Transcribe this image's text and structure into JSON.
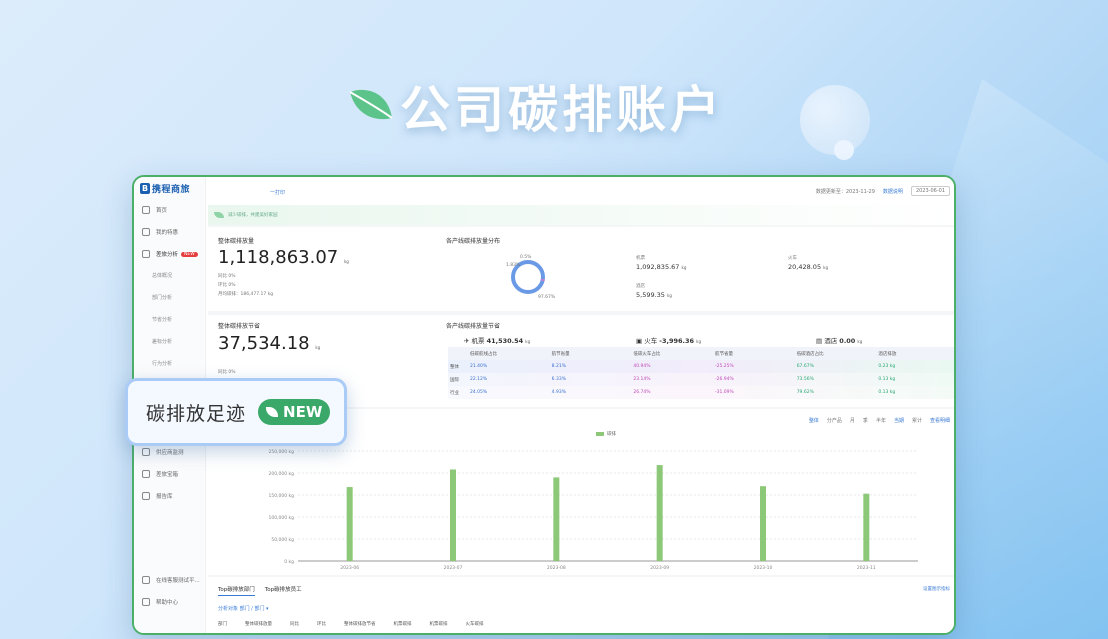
{
  "hero": {
    "title": "公司碳排账户"
  },
  "popup": {
    "label": "碳排放足迹",
    "badge": "NEW"
  },
  "sidebar": {
    "brand": "携程商旅",
    "items": [
      {
        "label": "首页"
      },
      {
        "label": "我的特惠"
      },
      {
        "label": "差旅分析",
        "badge": "NEW"
      }
    ],
    "sub_items": [
      "总体概况",
      "部门分析",
      "节省分析",
      "差标分析",
      "行为分析"
    ],
    "lower_items": [
      "供应商监测",
      "差旅宝箱",
      "报告库"
    ],
    "bottom_items": [
      "在线客服测试平...",
      "帮助中心"
    ]
  },
  "topbar": {
    "tab": "一打印",
    "update_text": "数据更新至：2023-11-29",
    "help": "数据说明",
    "date": "2023-06-01"
  },
  "banner": {
    "text": "减少碳排，共建美好家园"
  },
  "card1": {
    "title": "整体碳排放量",
    "value": "1,118,863.07",
    "unit": "kg",
    "rows": [
      "同比  0%",
      "环比  0%",
      "月均碳排：186,477.17 kg"
    ],
    "dist_title": "各产线碳排放量分布",
    "donut_labels": [
      "0.5%",
      "1.83%",
      "97.67%"
    ],
    "stats": [
      {
        "cap": "机票",
        "value": "1,092,835.67",
        "unit": "kg"
      },
      {
        "cap": "火车",
        "value": "20,428.05",
        "unit": "kg"
      },
      {
        "cap": "酒店",
        "value": "5,599.35",
        "unit": "kg"
      }
    ]
  },
  "card2": {
    "title": "整体碳排放节省",
    "value": "37,534.18",
    "unit": "kg",
    "row": "同比  0%",
    "saving_title": "各产线碳排放量节省",
    "savings": [
      {
        "cap": "机票",
        "value": "41,530.54",
        "unit": "kg"
      },
      {
        "cap": "火车",
        "value": "-3,996.36",
        "unit": "kg"
      },
      {
        "cap": "酒店",
        "value": "0.00",
        "unit": "kg"
      }
    ],
    "headers": [
      "",
      "低碳航线占比",
      "航节省量",
      "低碳火车占比",
      "航节省量",
      "低碳酒店占比",
      "酒店排放"
    ],
    "rows": [
      [
        "整体",
        "21.40%",
        "8.21%",
        "40.94%",
        "-25.25%",
        "67.67%",
        "0.23 kg"
      ],
      [
        "国际",
        "22.12%",
        "6.33%",
        "23.14%",
        "-26.94%",
        "73.56%",
        "0.13 kg"
      ],
      [
        "行业",
        "24.05%",
        "4.93%",
        "26.74%",
        "-31.09%",
        "79.62%",
        "0.13 kg"
      ]
    ]
  },
  "chart_controls": {
    "items": [
      "整体",
      "分产品",
      "月",
      "季",
      "半年",
      "当期",
      "累计"
    ],
    "export": "查看明细"
  },
  "chart_data": {
    "type": "bar",
    "categories": [
      "2023-06",
      "2023-07",
      "2023-08",
      "2023-09",
      "2023-10",
      "2023-11"
    ],
    "series": [
      {
        "name": "碳排",
        "values": [
          168000,
          208000,
          190000,
          218000,
          170000,
          153000
        ]
      }
    ],
    "ylim": [
      0,
      250000
    ],
    "yticks": [
      "0 kg",
      "50,000 kg",
      "100,000 kg",
      "150,000 kg",
      "200,000 kg",
      "250,000 kg"
    ],
    "color": "#8dc878"
  },
  "card4": {
    "tabs": [
      "Top碳排放部门",
      "Top碳排放员工"
    ],
    "filter": "分析对象   部门 / 部门 ▾",
    "export": "设置图示指标",
    "headers": [
      "部门",
      "整体碳排放量",
      "同比",
      "环比",
      "整体碳排放节省",
      "机票碳排",
      "机票碳排",
      "火车碳排"
    ]
  }
}
